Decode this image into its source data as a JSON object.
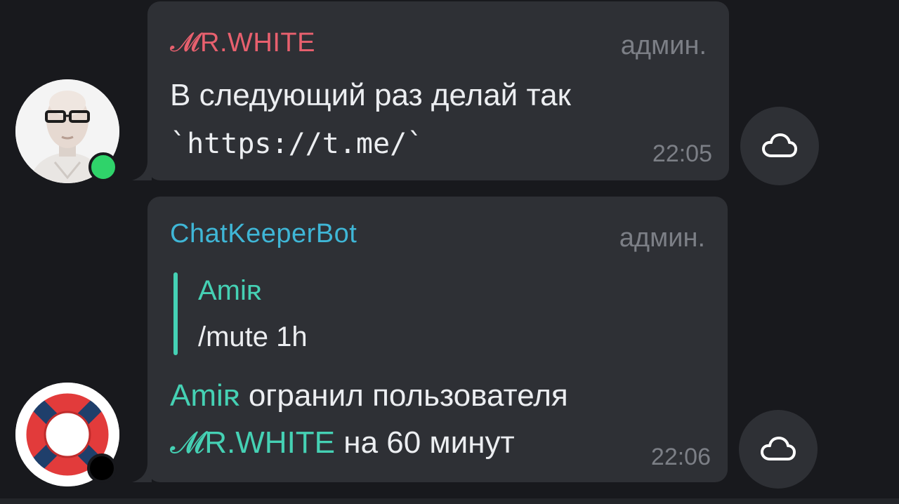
{
  "messages": [
    {
      "sender": "𝓜R.WHITE",
      "sender_color": "#e8606e",
      "role": "админ.",
      "line1": "В следующий раз делай так",
      "line2": "`https://t.me/`",
      "time": "22:05",
      "avatar": "bald-man-glasses-avatar",
      "status": "online"
    },
    {
      "sender": "ChatKeeperBot",
      "sender_color": "#3fb6d6",
      "role": "админ.",
      "reply_to": {
        "name": "Amiʀ",
        "text": "/mute 1h"
      },
      "actor": "Amiʀ",
      "line1_rest": " огранил пользователя",
      "target": "𝓜R.WHITE",
      "line2_rest": " на 60 минут",
      "time": "22:06",
      "avatar": "lifebuoy-avatar"
    }
  ],
  "icons": {
    "share": "cloud-icon"
  },
  "colors": {
    "background": "#18191d",
    "bubble": "#2e3035",
    "accent": "#45d1b4",
    "text": "#eceef1",
    "muted": "#7c7f86"
  }
}
